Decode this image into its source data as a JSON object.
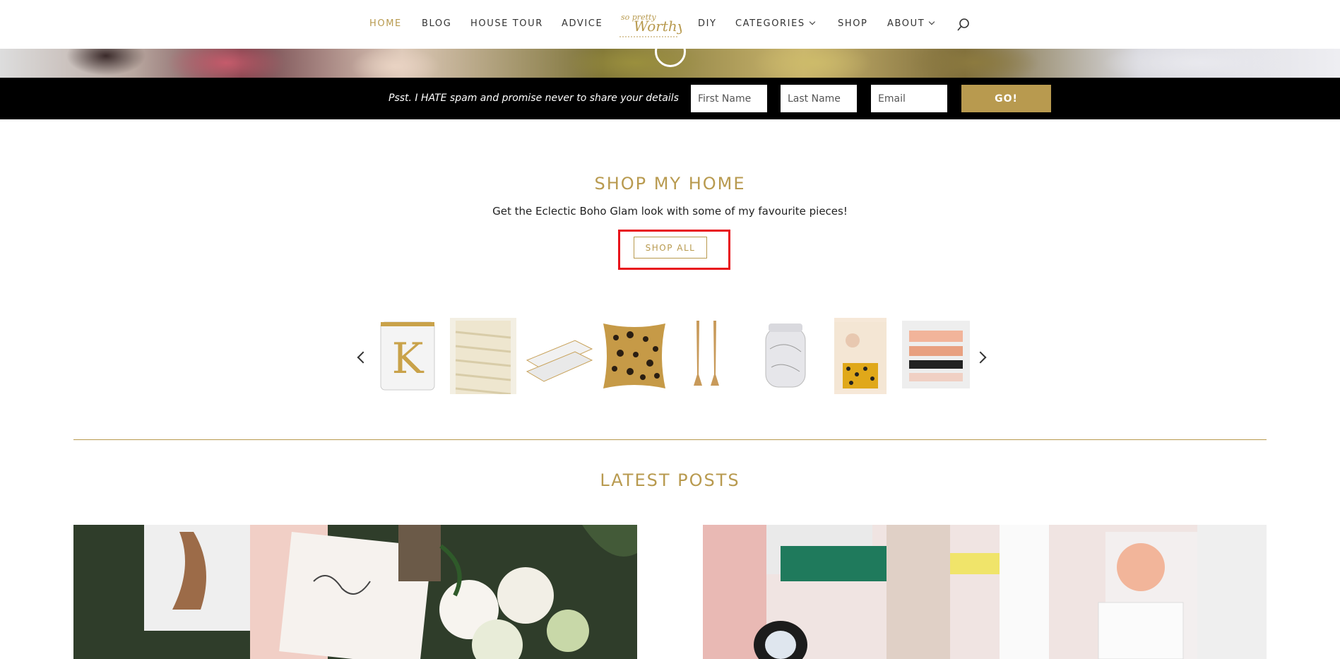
{
  "nav": {
    "items": [
      {
        "label": "HOME",
        "active": true
      },
      {
        "label": "BLOG"
      },
      {
        "label": "HOUSE TOUR"
      },
      {
        "label": "ADVICE"
      },
      {
        "label": "DIY"
      },
      {
        "label": "CATEGORIES",
        "dropdown": true
      },
      {
        "label": "SHOP"
      },
      {
        "label": "ABOUT",
        "dropdown": true
      }
    ],
    "logo_text": "so Pretty Worthy"
  },
  "signup": {
    "text": "Psst. I HATE spam and promise never to share your details",
    "first_name_placeholder": "First Name",
    "last_name_placeholder": "Last Name",
    "email_placeholder": "Email",
    "submit_label": "GO!"
  },
  "shop": {
    "title": "SHOP MY HOME",
    "subtitle": "Get the Eclectic Boho Glam look with some of my favourite pieces!",
    "button_label": "SHOP ALL",
    "products": [
      {
        "name": "monogram-glass-icon"
      },
      {
        "name": "woven-rug-icon"
      },
      {
        "name": "stapler-icon"
      },
      {
        "name": "leopard-pillow-icon"
      },
      {
        "name": "candlesticks-icon"
      },
      {
        "name": "marble-jar-icon"
      },
      {
        "name": "fashion-print-icon"
      },
      {
        "name": "art-pillow-icon"
      }
    ]
  },
  "latest": {
    "title": "LATEST POSTS"
  },
  "colors": {
    "accent": "#b89a4f",
    "highlight": "#e8131b",
    "signup_bg": "#000000"
  }
}
